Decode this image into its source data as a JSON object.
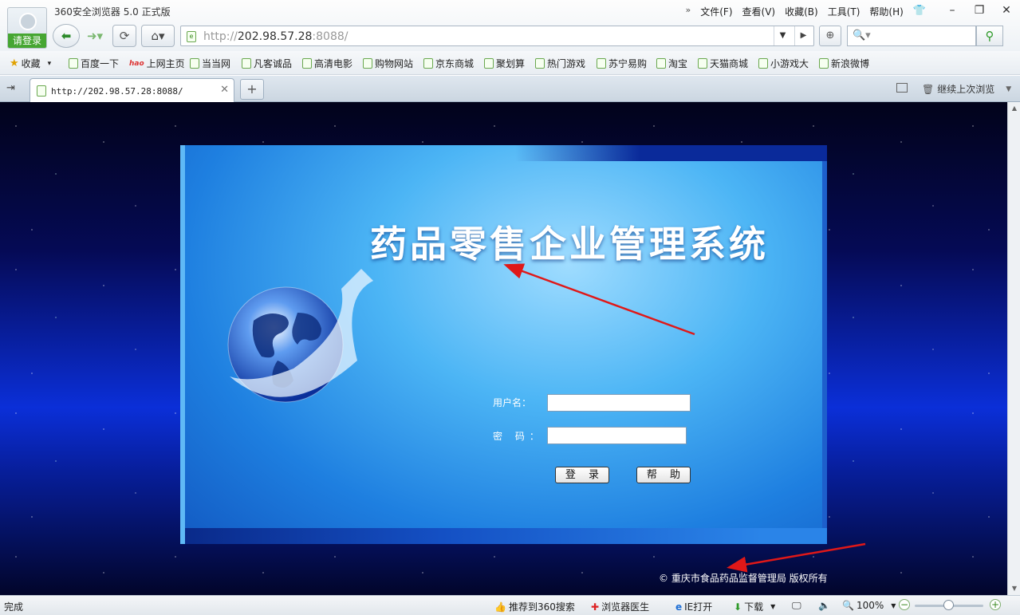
{
  "window": {
    "title": "360安全浏览器 5.0 正式版",
    "login_label": "请登录",
    "menus": [
      "文件(F)",
      "查看(V)",
      "收藏(B)",
      "工具(T)",
      "帮助(H)"
    ],
    "menu_more_glyph": "»"
  },
  "nav": {
    "address_host": "202.98.57.28",
    "address_prefix": "http://",
    "address_suffix": ":8088/"
  },
  "favorites": {
    "collect_label": "收藏",
    "items": [
      "百度一下",
      "上网主页",
      "当当网",
      "凡客诚品",
      "高清电影",
      "购物网站",
      "京东商城",
      "聚划算",
      "热门游戏",
      "苏宁易购",
      "淘宝",
      "天猫商城",
      "小游戏大",
      "新浪微博"
    ],
    "hao_badge": "hao"
  },
  "tabs": {
    "active_tab_label": "http://202.98.57.28:8088/",
    "restore_label": "继续上次浏览"
  },
  "page": {
    "system_title": "药品零售企业管理系统",
    "username_label": "用户名：",
    "password_label": "密 码：",
    "login_button": "登 录",
    "help_button": "帮 助",
    "copyright": "© 重庆市食品药品监督管理局 版权所有"
  },
  "statusbar": {
    "status": "完成",
    "recommend": "推荐到360搜索",
    "doctor": "浏览器医生",
    "ie_open": "IE打开",
    "download": "下载",
    "zoom": "100%"
  },
  "colors": {
    "accent_green": "#46a632",
    "page_panel": "#1e7fe0",
    "annotation_arrow": "#e01818"
  }
}
